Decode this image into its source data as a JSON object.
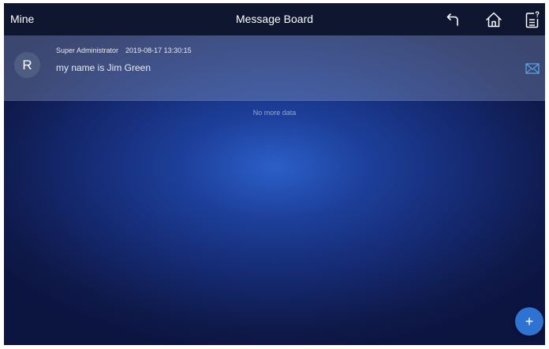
{
  "header": {
    "left_title": "Mine",
    "title": "Message Board",
    "icons": [
      "back-arrow-icon",
      "home-icon",
      "notes-icon"
    ]
  },
  "messages": [
    {
      "avatar_letter": "R",
      "author": "Super Administrator",
      "timestamp": "2019-08-17 13:30:15",
      "text": "my name is Jim Green",
      "action_icon": "mail-icon"
    }
  ],
  "footer_text": "No more data",
  "fab": {
    "label": "+"
  },
  "colors": {
    "topbar": "#0e1630",
    "accent": "#2e72d2",
    "mail_icon": "#5aa8ea"
  }
}
